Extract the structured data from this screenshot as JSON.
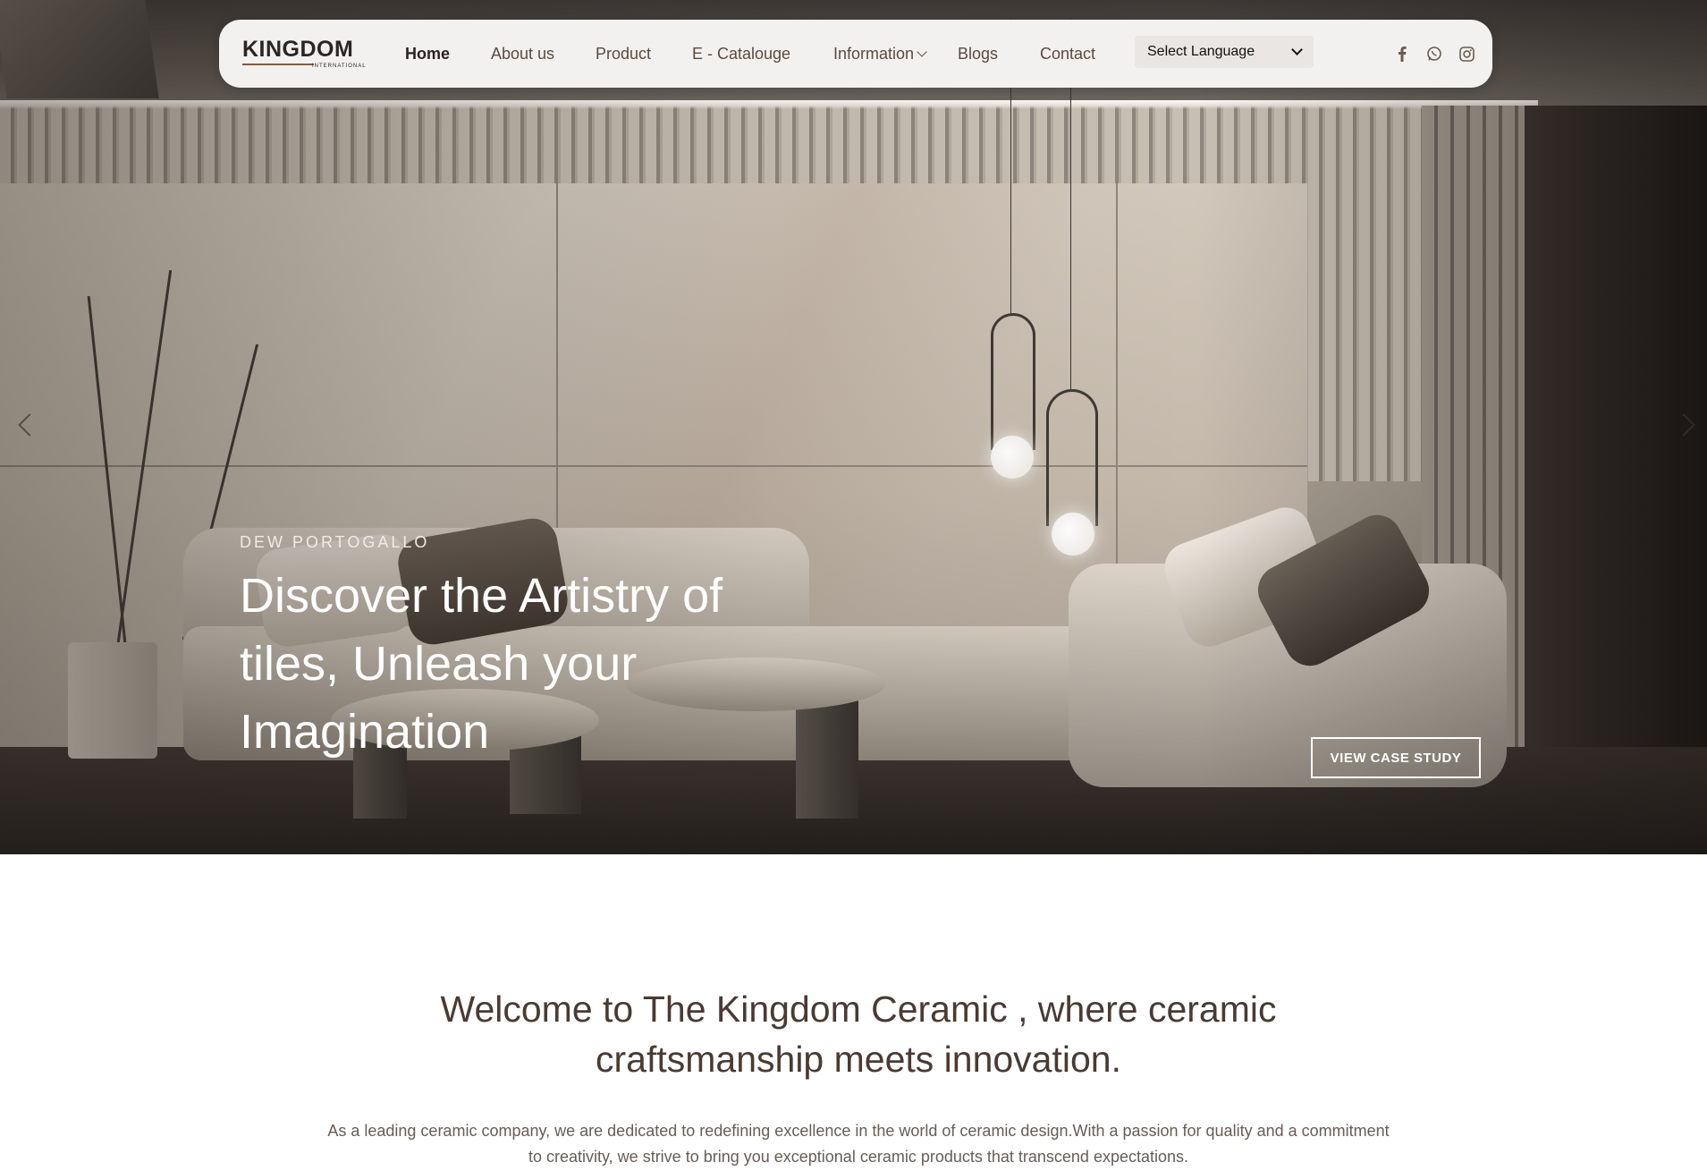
{
  "nav": {
    "logo": "KINGDOM",
    "logo_sub": "INTERNATIONAL",
    "items": [
      {
        "label": "Home"
      },
      {
        "label": "About us"
      },
      {
        "label": "Product"
      },
      {
        "label": "E - Catalouge"
      },
      {
        "label": "Information"
      },
      {
        "label": "Blogs"
      },
      {
        "label": "Contact"
      }
    ],
    "language_select": "Select Language",
    "social_icons": [
      "facebook-icon",
      "whatsapp-icon",
      "instagram-icon"
    ]
  },
  "hero": {
    "eyebrow": "DEW PORTOGALLO",
    "headline": "Discover the Artistry of tiles, Unleash your Imagination",
    "cta": "VIEW CASE STUDY"
  },
  "welcome": {
    "heading": "Welcome to The Kingdom Ceramic , where ceramic craftsmanship meets innovation.",
    "body": "As a leading ceramic company, we are dedicated to redefining excellence in the world of ceramic design.With a passion for quality and a commitment to creativity, we strive to bring you exceptional ceramic products that transcend expectations."
  },
  "colors": {
    "nav_bg": "#f3f1ef",
    "text_brown": "#4a3a32",
    "accent": "#8a5a3c"
  }
}
